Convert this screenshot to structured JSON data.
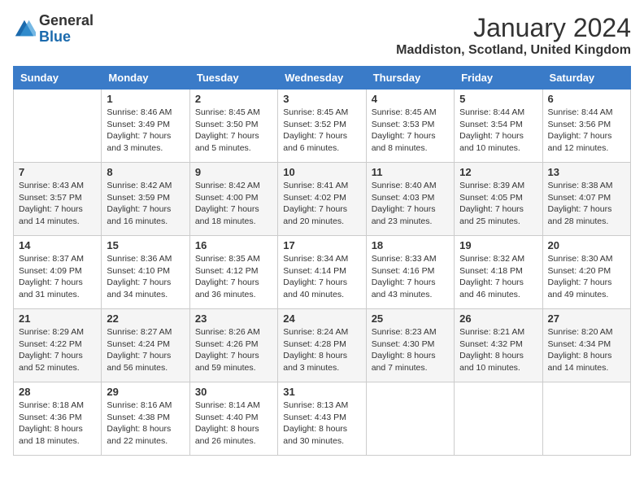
{
  "header": {
    "logo_general": "General",
    "logo_blue": "Blue",
    "month_title": "January 2024",
    "location": "Maddiston, Scotland, United Kingdom"
  },
  "days_of_week": [
    "Sunday",
    "Monday",
    "Tuesday",
    "Wednesday",
    "Thursday",
    "Friday",
    "Saturday"
  ],
  "weeks": [
    [
      {
        "day": "",
        "info": ""
      },
      {
        "day": "1",
        "info": "Sunrise: 8:46 AM\nSunset: 3:49 PM\nDaylight: 7 hours\nand 3 minutes."
      },
      {
        "day": "2",
        "info": "Sunrise: 8:45 AM\nSunset: 3:50 PM\nDaylight: 7 hours\nand 5 minutes."
      },
      {
        "day": "3",
        "info": "Sunrise: 8:45 AM\nSunset: 3:52 PM\nDaylight: 7 hours\nand 6 minutes."
      },
      {
        "day": "4",
        "info": "Sunrise: 8:45 AM\nSunset: 3:53 PM\nDaylight: 7 hours\nand 8 minutes."
      },
      {
        "day": "5",
        "info": "Sunrise: 8:44 AM\nSunset: 3:54 PM\nDaylight: 7 hours\nand 10 minutes."
      },
      {
        "day": "6",
        "info": "Sunrise: 8:44 AM\nSunset: 3:56 PM\nDaylight: 7 hours\nand 12 minutes."
      }
    ],
    [
      {
        "day": "7",
        "info": "Sunrise: 8:43 AM\nSunset: 3:57 PM\nDaylight: 7 hours\nand 14 minutes."
      },
      {
        "day": "8",
        "info": "Sunrise: 8:42 AM\nSunset: 3:59 PM\nDaylight: 7 hours\nand 16 minutes."
      },
      {
        "day": "9",
        "info": "Sunrise: 8:42 AM\nSunset: 4:00 PM\nDaylight: 7 hours\nand 18 minutes."
      },
      {
        "day": "10",
        "info": "Sunrise: 8:41 AM\nSunset: 4:02 PM\nDaylight: 7 hours\nand 20 minutes."
      },
      {
        "day": "11",
        "info": "Sunrise: 8:40 AM\nSunset: 4:03 PM\nDaylight: 7 hours\nand 23 minutes."
      },
      {
        "day": "12",
        "info": "Sunrise: 8:39 AM\nSunset: 4:05 PM\nDaylight: 7 hours\nand 25 minutes."
      },
      {
        "day": "13",
        "info": "Sunrise: 8:38 AM\nSunset: 4:07 PM\nDaylight: 7 hours\nand 28 minutes."
      }
    ],
    [
      {
        "day": "14",
        "info": "Sunrise: 8:37 AM\nSunset: 4:09 PM\nDaylight: 7 hours\nand 31 minutes."
      },
      {
        "day": "15",
        "info": "Sunrise: 8:36 AM\nSunset: 4:10 PM\nDaylight: 7 hours\nand 34 minutes."
      },
      {
        "day": "16",
        "info": "Sunrise: 8:35 AM\nSunset: 4:12 PM\nDaylight: 7 hours\nand 36 minutes."
      },
      {
        "day": "17",
        "info": "Sunrise: 8:34 AM\nSunset: 4:14 PM\nDaylight: 7 hours\nand 40 minutes."
      },
      {
        "day": "18",
        "info": "Sunrise: 8:33 AM\nSunset: 4:16 PM\nDaylight: 7 hours\nand 43 minutes."
      },
      {
        "day": "19",
        "info": "Sunrise: 8:32 AM\nSunset: 4:18 PM\nDaylight: 7 hours\nand 46 minutes."
      },
      {
        "day": "20",
        "info": "Sunrise: 8:30 AM\nSunset: 4:20 PM\nDaylight: 7 hours\nand 49 minutes."
      }
    ],
    [
      {
        "day": "21",
        "info": "Sunrise: 8:29 AM\nSunset: 4:22 PM\nDaylight: 7 hours\nand 52 minutes."
      },
      {
        "day": "22",
        "info": "Sunrise: 8:27 AM\nSunset: 4:24 PM\nDaylight: 7 hours\nand 56 minutes."
      },
      {
        "day": "23",
        "info": "Sunrise: 8:26 AM\nSunset: 4:26 PM\nDaylight: 7 hours\nand 59 minutes."
      },
      {
        "day": "24",
        "info": "Sunrise: 8:24 AM\nSunset: 4:28 PM\nDaylight: 8 hours\nand 3 minutes."
      },
      {
        "day": "25",
        "info": "Sunrise: 8:23 AM\nSunset: 4:30 PM\nDaylight: 8 hours\nand 7 minutes."
      },
      {
        "day": "26",
        "info": "Sunrise: 8:21 AM\nSunset: 4:32 PM\nDaylight: 8 hours\nand 10 minutes."
      },
      {
        "day": "27",
        "info": "Sunrise: 8:20 AM\nSunset: 4:34 PM\nDaylight: 8 hours\nand 14 minutes."
      }
    ],
    [
      {
        "day": "28",
        "info": "Sunrise: 8:18 AM\nSunset: 4:36 PM\nDaylight: 8 hours\nand 18 minutes."
      },
      {
        "day": "29",
        "info": "Sunrise: 8:16 AM\nSunset: 4:38 PM\nDaylight: 8 hours\nand 22 minutes."
      },
      {
        "day": "30",
        "info": "Sunrise: 8:14 AM\nSunset: 4:40 PM\nDaylight: 8 hours\nand 26 minutes."
      },
      {
        "day": "31",
        "info": "Sunrise: 8:13 AM\nSunset: 4:43 PM\nDaylight: 8 hours\nand 30 minutes."
      },
      {
        "day": "",
        "info": ""
      },
      {
        "day": "",
        "info": ""
      },
      {
        "day": "",
        "info": ""
      }
    ]
  ]
}
